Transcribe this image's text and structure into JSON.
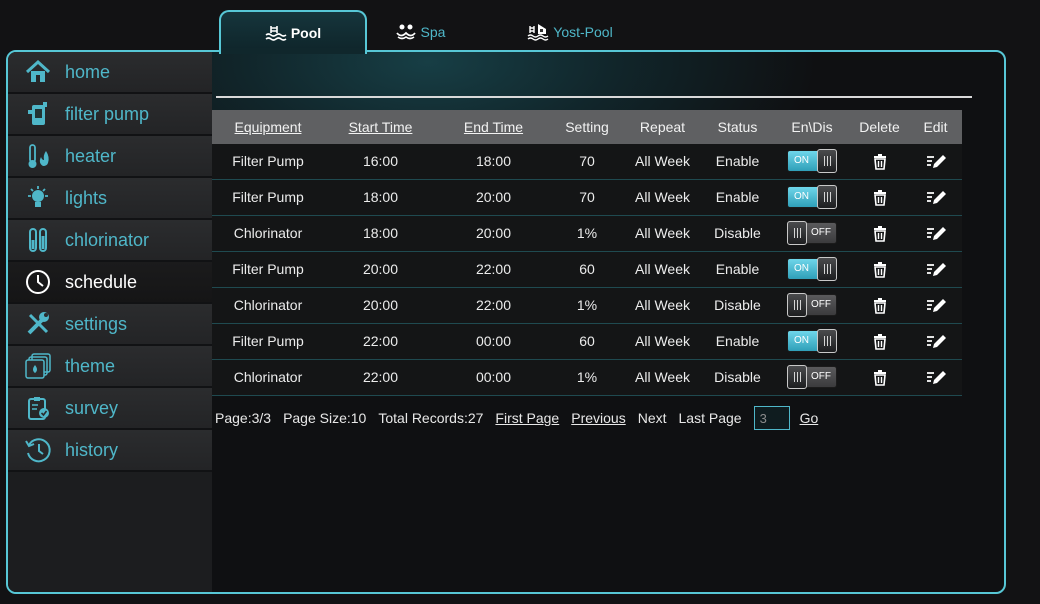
{
  "tabs": [
    {
      "label": "Pool",
      "icon": "pool-waves-icon",
      "active": true
    },
    {
      "label": "Spa",
      "icon": "spa-people-icon",
      "active": false
    },
    {
      "label": "Yost-Pool",
      "icon": "pool-house-icon",
      "active": false
    }
  ],
  "sidebar": {
    "items": [
      {
        "label": "home",
        "icon": "home-icon"
      },
      {
        "label": "filter pump",
        "icon": "filter-pump-icon"
      },
      {
        "label": "heater",
        "icon": "heater-icon"
      },
      {
        "label": "lights",
        "icon": "light-bulb-icon"
      },
      {
        "label": "chlorinator",
        "icon": "chlorinator-icon"
      },
      {
        "label": "schedule",
        "icon": "clock-icon",
        "active": true
      },
      {
        "label": "settings",
        "icon": "tools-icon"
      },
      {
        "label": "theme",
        "icon": "theme-icon"
      },
      {
        "label": "survey",
        "icon": "survey-icon"
      },
      {
        "label": "history",
        "icon": "history-icon"
      }
    ]
  },
  "table": {
    "headers": [
      "Equipment",
      "Start Time",
      "End Time",
      "Setting",
      "Repeat",
      "Status",
      "En\\Dis",
      "Delete",
      "Edit"
    ],
    "rows": [
      {
        "equipment": "Filter Pump",
        "start": "16:00",
        "end": "18:00",
        "setting": "70",
        "repeat": "All Week",
        "status": "Enable",
        "toggle": "ON"
      },
      {
        "equipment": "Filter Pump",
        "start": "18:00",
        "end": "20:00",
        "setting": "70",
        "repeat": "All Week",
        "status": "Enable",
        "toggle": "ON"
      },
      {
        "equipment": "Chlorinator",
        "start": "18:00",
        "end": "20:00",
        "setting": "1%",
        "repeat": "All Week",
        "status": "Disable",
        "toggle": "OFF"
      },
      {
        "equipment": "Filter Pump",
        "start": "20:00",
        "end": "22:00",
        "setting": "60",
        "repeat": "All Week",
        "status": "Enable",
        "toggle": "ON"
      },
      {
        "equipment": "Chlorinator",
        "start": "20:00",
        "end": "22:00",
        "setting": "1%",
        "repeat": "All Week",
        "status": "Disable",
        "toggle": "OFF"
      },
      {
        "equipment": "Filter Pump",
        "start": "22:00",
        "end": "00:00",
        "setting": "60",
        "repeat": "All Week",
        "status": "Enable",
        "toggle": "ON"
      },
      {
        "equipment": "Chlorinator",
        "start": "22:00",
        "end": "00:00",
        "setting": "1%",
        "repeat": "All Week",
        "status": "Disable",
        "toggle": "OFF"
      }
    ]
  },
  "pager": {
    "page": "Page:3/3",
    "page_size": "Page Size:10",
    "total": "Total Records:27",
    "first": "First Page",
    "previous": "Previous",
    "next": "Next",
    "last": "Last Page",
    "input_value": "3",
    "go": "Go"
  },
  "colors": {
    "accent": "#57c7d6",
    "link": "#4fb7c9",
    "header_bg": "#5f6062",
    "toggle_on": "#3fb3cb"
  }
}
